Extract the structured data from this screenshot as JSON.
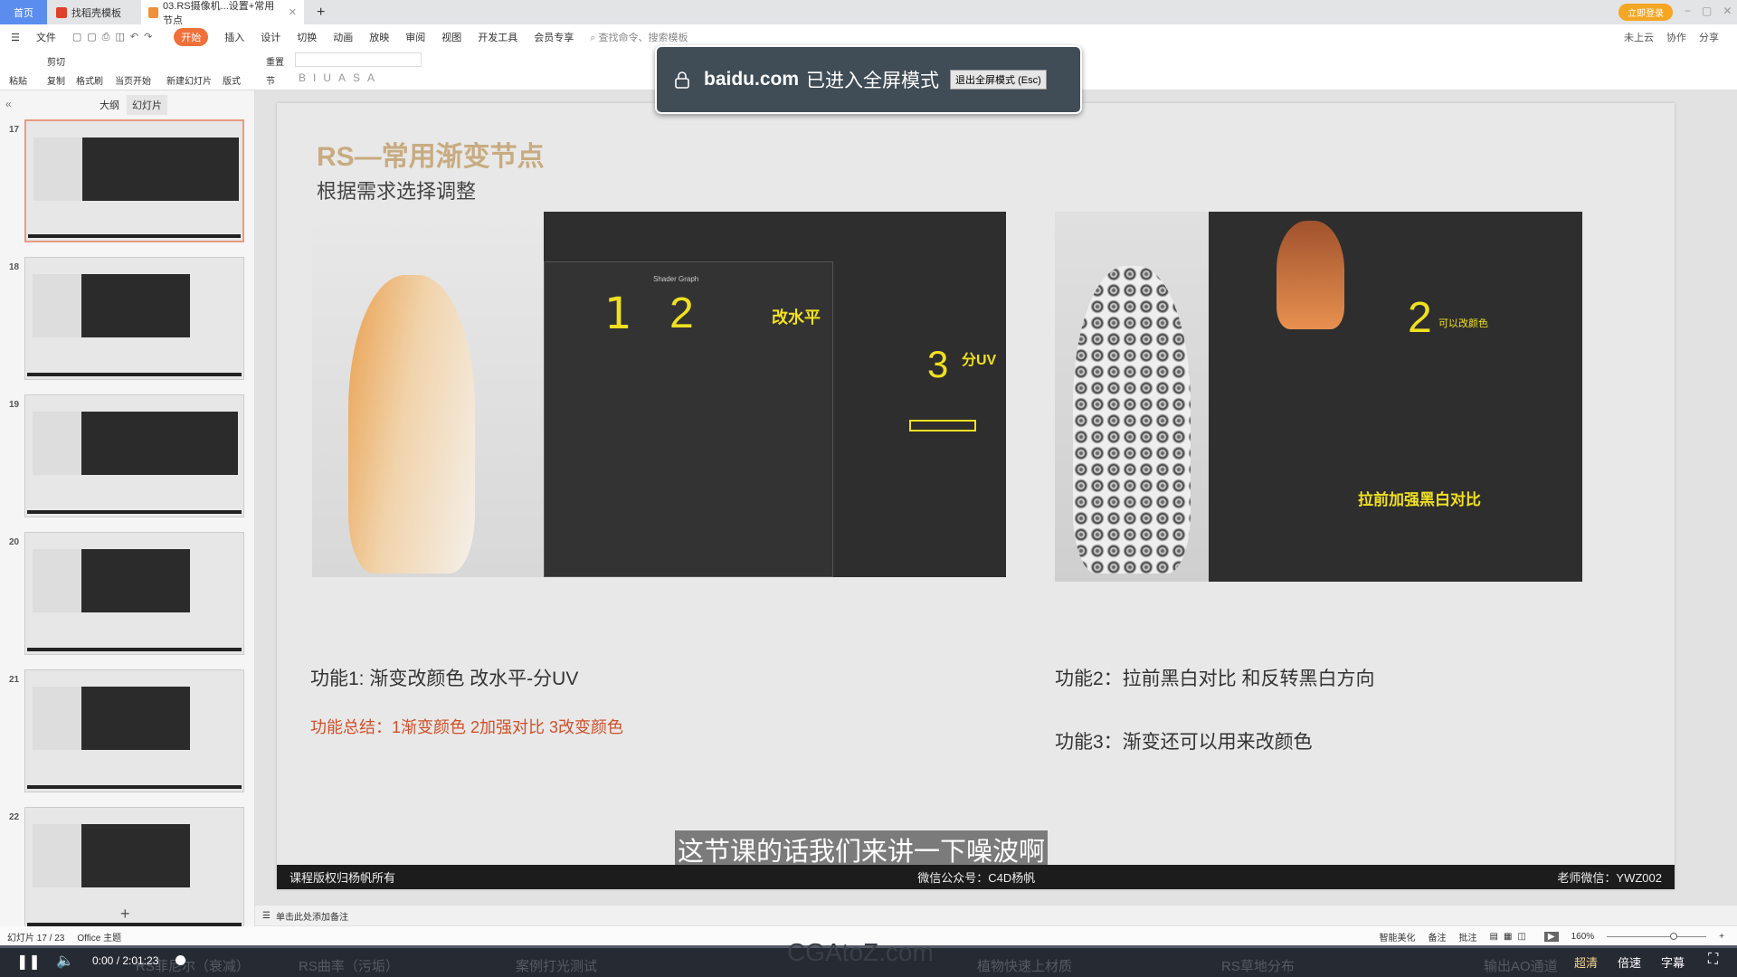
{
  "tabs": {
    "home": "首页",
    "template": "找稻壳模板",
    "doc": "03.RS摄像机...设置+常用节点"
  },
  "menu": [
    "文件",
    "开始",
    "插入",
    "设计",
    "切换",
    "动画",
    "放映",
    "审阅",
    "视图",
    "开发工具",
    "会员专享"
  ],
  "menu_active": "开始",
  "search_placeholder": "查找命令、搜索模板",
  "titlebar_right": {
    "login": "立即登录",
    "cloud": "未上云",
    "collab": "协作",
    "share": "分享"
  },
  "ribbon": {
    "paste": "粘贴",
    "cut": "剪切",
    "copy": "复制",
    "format_painter": "格式刷",
    "play_current": "当页开始",
    "new_slide": "新建幻灯片",
    "layout": "版式",
    "reset": "重置",
    "section": "节"
  },
  "panel": {
    "outline_tab": "大纲",
    "slides_tab": "幻灯片",
    "add": "+"
  },
  "thumbnails": [
    "17",
    "18",
    "19",
    "20",
    "21",
    "22"
  ],
  "slide": {
    "title": "RS—常用渐变节点",
    "subtitle": "根据需求选择调整",
    "func1": "功能1: 渐变改颜色 改水平-分UV",
    "summary": "功能总结：1渐变颜色 2加强对比 3改变颜色",
    "func2": "功能2：拉前黑白对比 和反转黑白方向",
    "func3": "功能3：渐变还可以用来改颜色",
    "annot_left": [
      "1",
      "2",
      "改水平",
      "3",
      "分UV"
    ],
    "annot_right": [
      "2",
      "可以改颜色",
      "拉前加强黑白对比"
    ],
    "shader_graph": "Shader Graph",
    "footer_left": "课程版权归杨帆所有",
    "footer_center": "微信公众号：C4D杨帆",
    "footer_right": "老师微信：YWZ002"
  },
  "caption": "这节课的话我们来讲一下噪波啊",
  "popup": {
    "domain": "baidu.com",
    "message": "已进入全屏模式",
    "exit_button": "退出全屏模式 (Esc)"
  },
  "notes_placeholder": "单击此处添加备注",
  "status": {
    "slide_count": "幻灯片 17 / 23",
    "theme": "Office 主题",
    "beautify": "智能美化",
    "notes": "备注",
    "comment": "批注",
    "zoom": "160%"
  },
  "player": {
    "time": "0:00 / 2:01:23",
    "progress": 0,
    "quality": "超清",
    "speed": "倍速",
    "subtitle": "字幕",
    "watermark": "CGAtoZ.com",
    "chapters": [
      "RS菲尼尔（衰减）",
      "RS曲率（污垢）",
      "案例打光测试",
      "植物快速上材质",
      "RS草地分布",
      "输出AO通道"
    ]
  },
  "colors": {
    "accent": "#f0703a",
    "title": "#c8ab80",
    "summary": "#d2502a",
    "home_tab": "#5b8def"
  }
}
